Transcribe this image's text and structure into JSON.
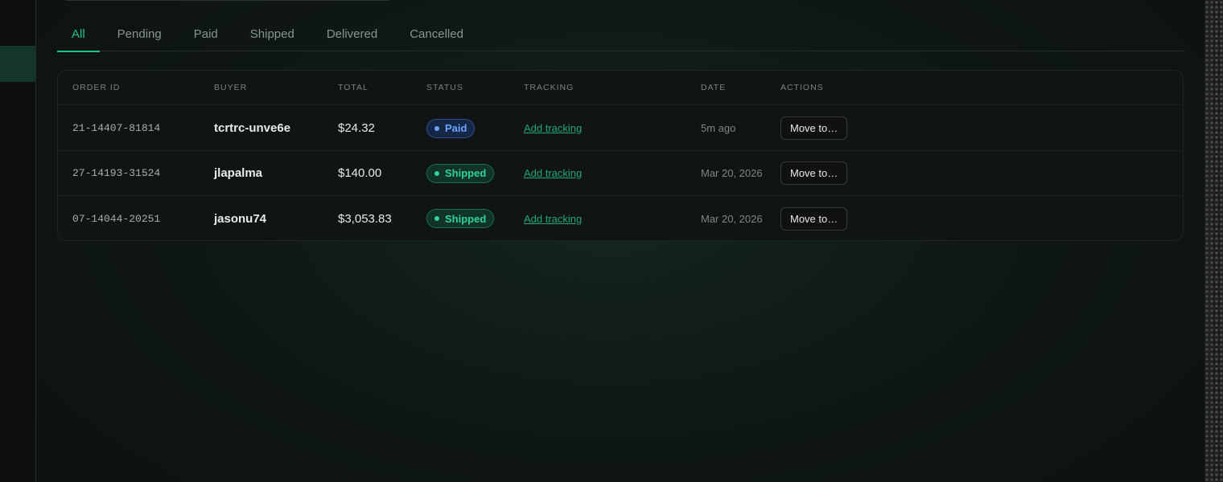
{
  "tabs": [
    {
      "label": "All",
      "active": true
    },
    {
      "label": "Pending",
      "active": false
    },
    {
      "label": "Paid",
      "active": false
    },
    {
      "label": "Shipped",
      "active": false
    },
    {
      "label": "Delivered",
      "active": false
    },
    {
      "label": "Cancelled",
      "active": false
    }
  ],
  "table": {
    "headers": {
      "order_id": "ORDER ID",
      "buyer": "BUYER",
      "total": "TOTAL",
      "status": "STATUS",
      "tracking": "TRACKING",
      "date": "DATE",
      "actions": "ACTIONS"
    },
    "rows": [
      {
        "order_id": "21-14407-81814",
        "buyer": "tcrtrc-unve6e",
        "total": "$24.32",
        "status": "Paid",
        "tracking": "Add tracking",
        "date": "5m ago",
        "action": "Move to…"
      },
      {
        "order_id": "27-14193-31524",
        "buyer": "jlapalma",
        "total": "$140.00",
        "status": "Shipped",
        "tracking": "Add tracking",
        "date": "Mar 20, 2026",
        "action": "Move to…"
      },
      {
        "order_id": "07-14044-20251",
        "buyer": "jasonu74",
        "total": "$3,053.83",
        "status": "Shipped",
        "tracking": "Add tracking",
        "date": "Mar 20, 2026",
        "action": "Move to…"
      }
    ]
  },
  "colors": {
    "accent": "#20c08c",
    "paid": "#6ea3ff",
    "shipped": "#2fd39a",
    "link": "#1ea87b"
  }
}
